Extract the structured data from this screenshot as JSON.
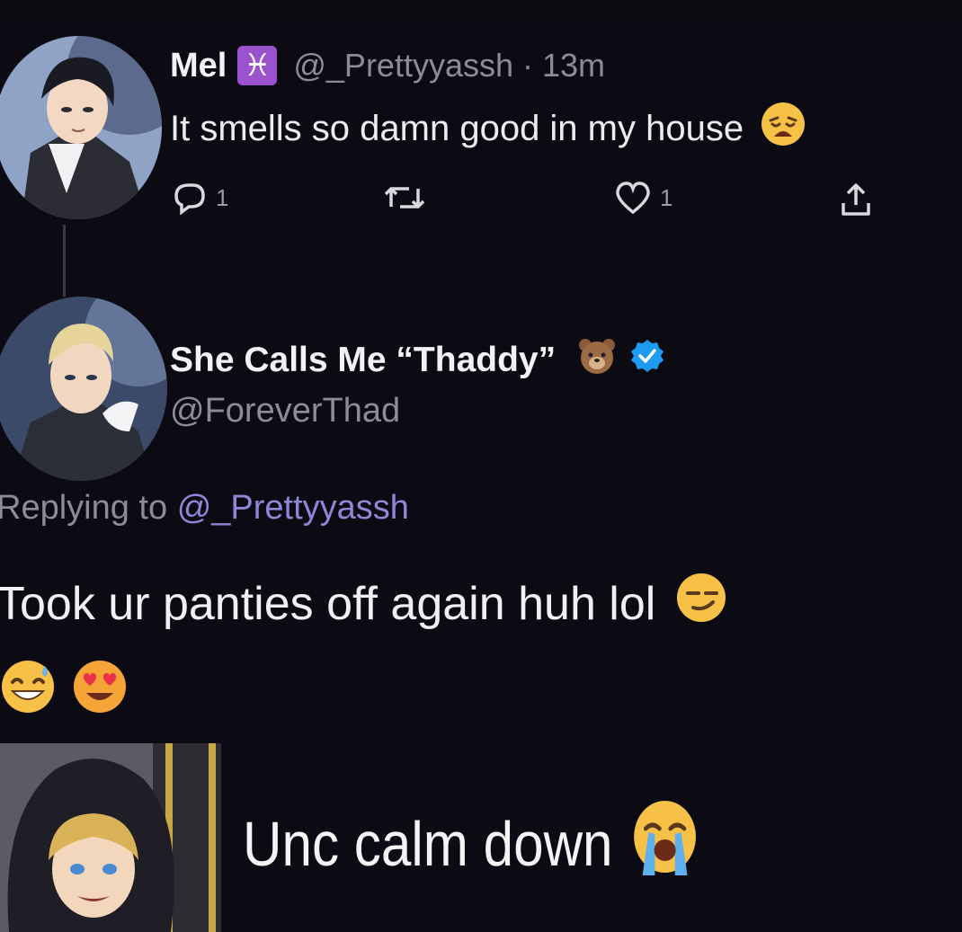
{
  "tweet": {
    "name": "Mel",
    "zodiac_symbol": "♓",
    "handle_time": "@_Prettyyassh · 13m",
    "text": "It smells so damn good in my house",
    "text_emoji": "weary-face-emoji",
    "reply_count": "1",
    "like_count": "1",
    "icons": [
      "reply-icon",
      "retweet-icon",
      "like-icon",
      "share-icon"
    ]
  },
  "reply": {
    "name": "She Calls Me “Thaddy”",
    "name_emoji": "bear-face-emoji",
    "verified_icon": "verified-badge-icon",
    "handle": "@ForeverThad",
    "replying_prefix": "Replying to",
    "replying_mention": "@_Prettyyassh",
    "text": "Took ur panties off again huh lol",
    "text_emojis": [
      "smirking-face-emoji",
      "grinning-sweat-face-emoji",
      "heart-eyes-face-emoji"
    ]
  },
  "caption": {
    "text": "Unc calm down",
    "emoji": "loudly-crying-face-emoji"
  },
  "colors": {
    "background": "#0c0b14",
    "handle_gray": "#8c8c98",
    "mention_purple": "#8e86d6",
    "verified_blue": "#1d9bf0",
    "pisces_purple": "#9a52cf"
  }
}
